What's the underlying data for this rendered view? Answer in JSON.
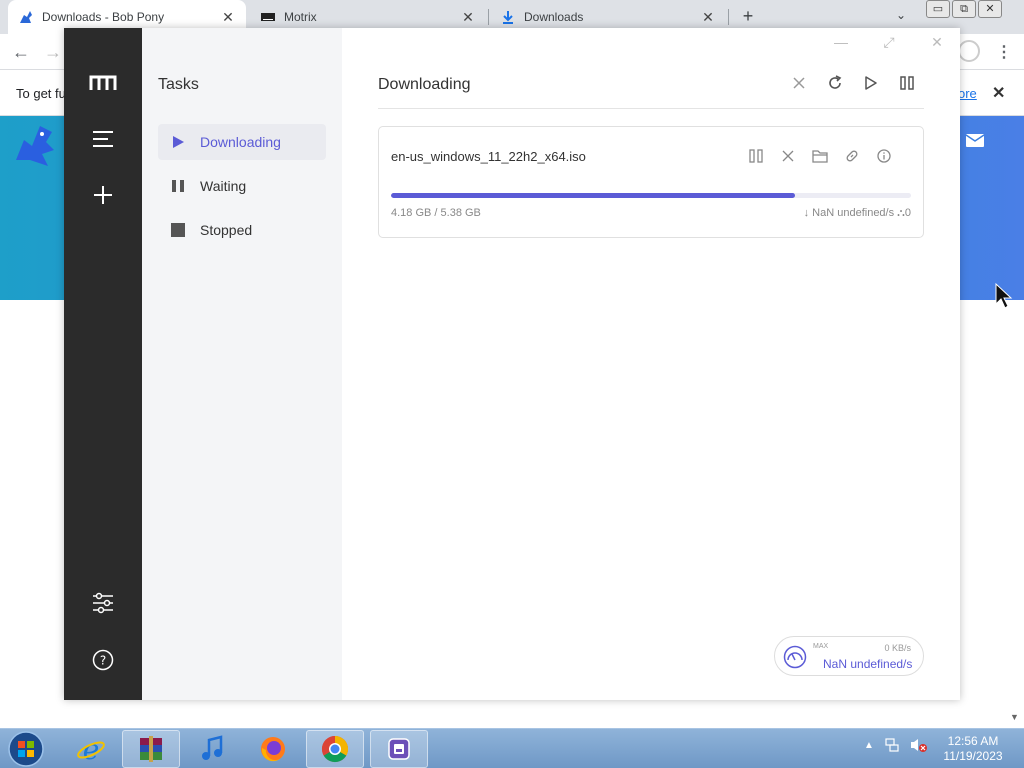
{
  "browser": {
    "tabs": [
      {
        "title": "Downloads - Bob Pony",
        "active": true
      },
      {
        "title": "Motrix",
        "active": false
      },
      {
        "title": "Downloads",
        "active": false
      }
    ],
    "new_tab": "+",
    "tab_search": "⌄",
    "window_buttons": [
      "▭",
      "⧉",
      "✕"
    ],
    "nav": {
      "back": "←",
      "forward": "→",
      "menu": "⋮"
    },
    "infobar": {
      "text": "To get fu",
      "link": "ore",
      "close": "✕"
    }
  },
  "motrix": {
    "window_controls": {
      "minimize": "—",
      "maximize": "⤢",
      "close": "✕"
    },
    "subnav": {
      "title": "Tasks",
      "items": [
        {
          "label": "Downloading",
          "icon": "play-icon",
          "active": true
        },
        {
          "label": "Waiting",
          "icon": "pause-icon",
          "active": false
        },
        {
          "label": "Stopped",
          "icon": "stop-icon",
          "active": false
        }
      ]
    },
    "main": {
      "title": "Downloading",
      "actions": [
        "close-icon",
        "refresh-icon",
        "play-icon",
        "pause-icon"
      ]
    },
    "task": {
      "name": "en-us_windows_11_22h2_x64.iso",
      "progress": 0.777,
      "size": "4.18 GB / 5.38 GB",
      "speed": "↓ NaN undefined/s",
      "connections": "⛬0",
      "actions": [
        "pause-icon",
        "delete-icon",
        "folder-icon",
        "link-icon",
        "info-icon"
      ]
    },
    "speed_widget": {
      "max_label": "MAX",
      "limit": "0 KB/s",
      "value": "NaN undefined/s"
    },
    "accent": "#5b5bd6",
    "rail_color": "#2b2b2b"
  },
  "taskbar": {
    "apps": [
      "ie-icon",
      "winrar-icon",
      "itunes-icon",
      "firefox-icon",
      "chrome-icon",
      "motrix-icon"
    ],
    "time": "12:56 AM",
    "date": "11/19/2023"
  }
}
